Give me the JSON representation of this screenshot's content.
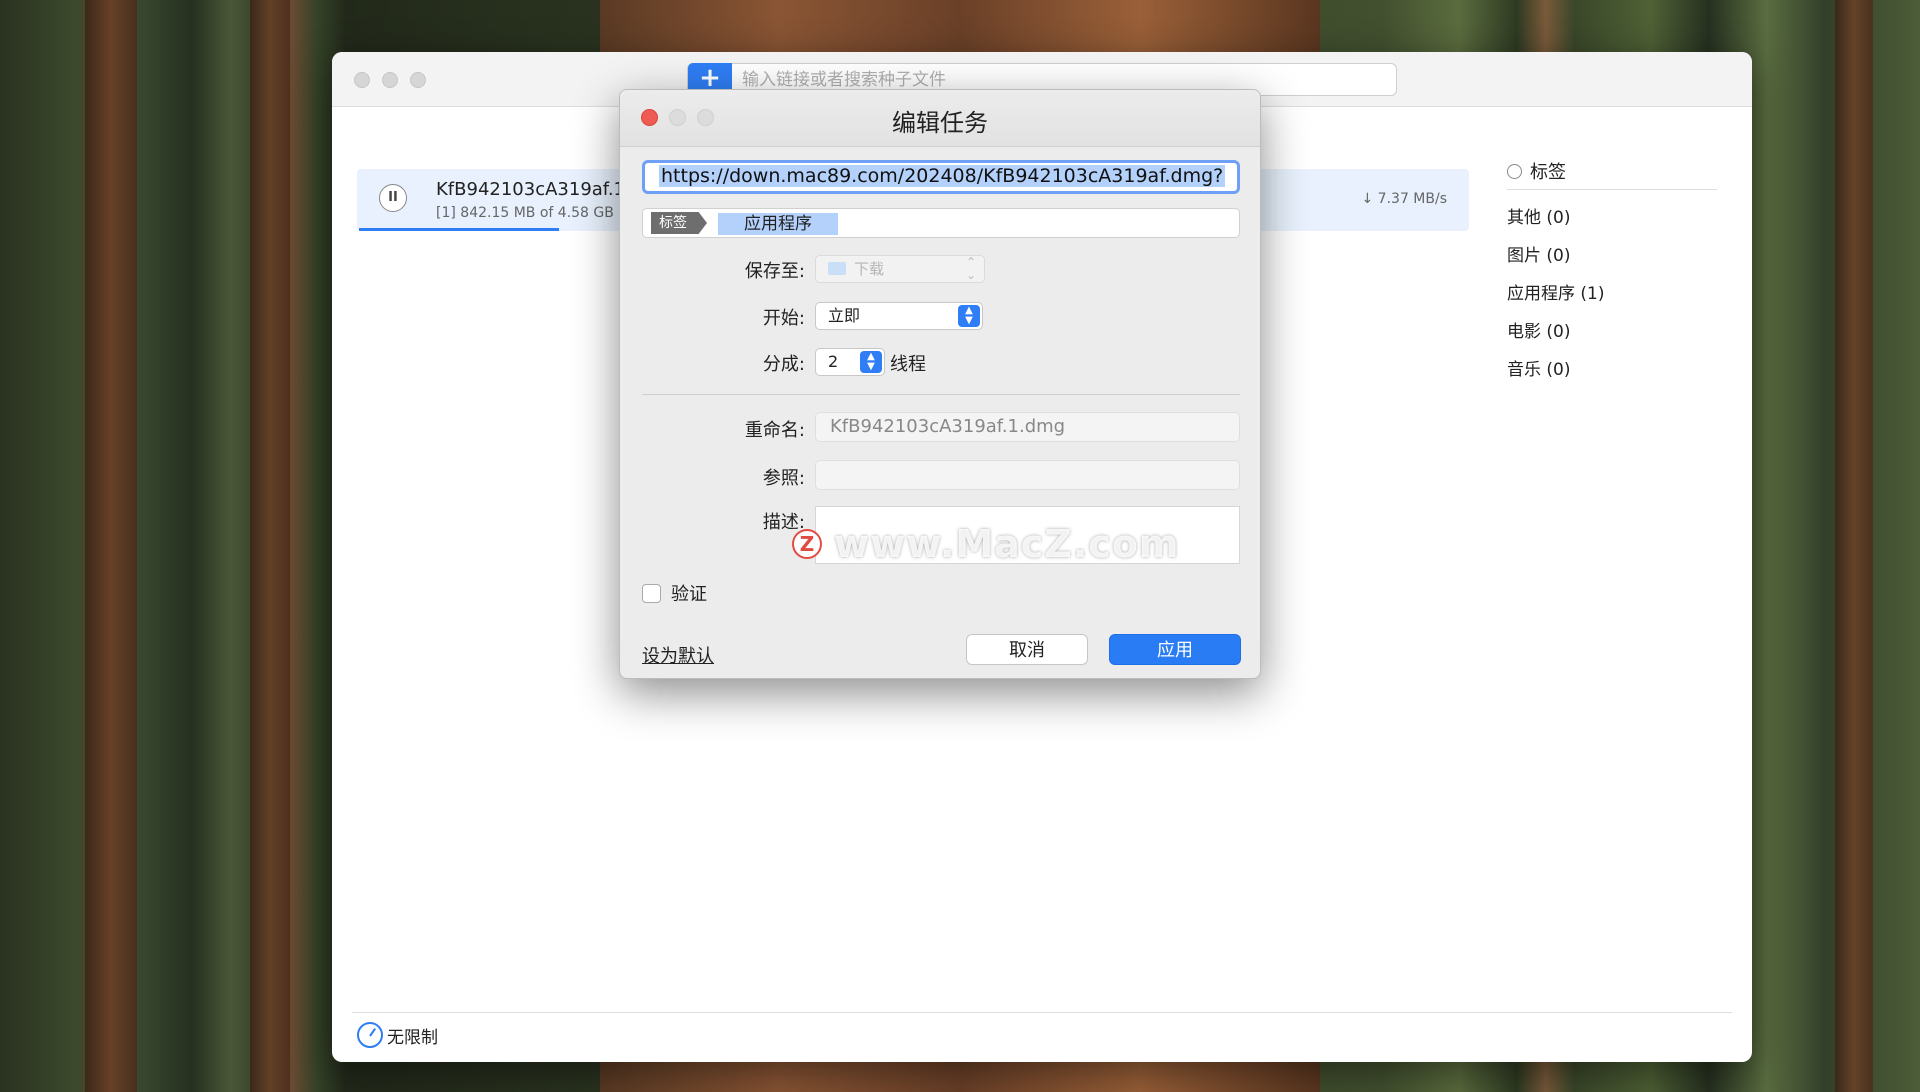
{
  "main": {
    "search_placeholder": "输入链接或者搜索种子文件",
    "add_glyph": "+",
    "download": {
      "name": "KfB942103cA319af.1",
      "info": "[1] 842.15 MB of 4.58 GB",
      "speed": "↓ 7.37 MB/s",
      "progress_fraction": 0.18,
      "pause_glyph": "II"
    },
    "tags_panel": {
      "header": "标签",
      "items": [
        "其他 (0)",
        "图片 (0)",
        "应用程序 (1)",
        "电影 (0)",
        "音乐 (0)"
      ]
    },
    "speed_limit_label": "无限制"
  },
  "dialog": {
    "title": "编辑任务",
    "url": "https://down.mac89.com/202408/KfB942103cA319af.dmg?",
    "tag_chip": "标签",
    "tag_value": "应用程序",
    "save_to_label": "保存至:",
    "save_to_value": "下载",
    "start_label": "开始:",
    "start_value": "立即",
    "split_label": "分成:",
    "split_value": "2",
    "split_suffix": "线程",
    "rename_label": "重命名:",
    "rename_value": "KfB942103cA319af.1.dmg",
    "reference_label": "参照:",
    "description_label": "描述:",
    "verify_label": "验证",
    "set_default_label": "设为默认",
    "cancel_label": "取消",
    "apply_label": "应用"
  },
  "watermark": {
    "logo_letter": "Z",
    "text": "www.MacZ.com"
  },
  "colors": {
    "accent": "#2f7ef5",
    "close_red": "#ee5b52",
    "row_highlight": "#e8f1fd"
  }
}
